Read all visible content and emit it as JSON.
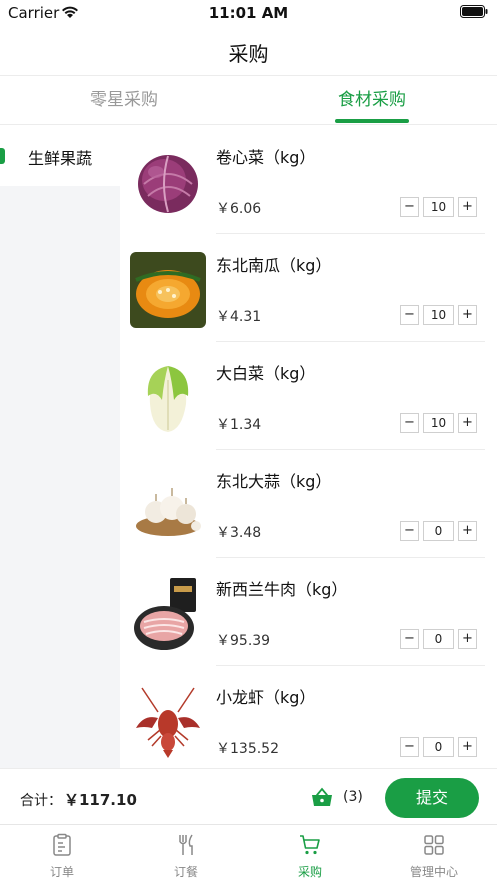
{
  "status_bar": {
    "carrier": "Carrier",
    "time": "11:01 AM"
  },
  "nav": {
    "title": "采购"
  },
  "tabs": [
    {
      "label": "零星采购",
      "active": false
    },
    {
      "label": "食材采购",
      "active": true
    }
  ],
  "sidebar": {
    "items": [
      {
        "label": "生鲜果蔬",
        "active": true
      }
    ]
  },
  "products": [
    {
      "name": "卷心菜（kg）",
      "price": "￥6.06",
      "quantity": "10",
      "image": "red-cabbage"
    },
    {
      "name": "东北南瓜（kg）",
      "price": "￥4.31",
      "quantity": "10",
      "image": "pumpkin"
    },
    {
      "name": "大白菜（kg）",
      "price": "￥1.34",
      "quantity": "10",
      "image": "napa-cabbage"
    },
    {
      "name": "东北大蒜（kg）",
      "price": "￥3.48",
      "quantity": "0",
      "image": "garlic"
    },
    {
      "name": "新西兰牛肉（kg）",
      "price": "￥95.39",
      "quantity": "0",
      "image": "beef-slices"
    },
    {
      "name": "小龙虾（kg）",
      "price": "￥135.52",
      "quantity": "0",
      "image": "crayfish"
    }
  ],
  "stepper": {
    "minus": "−",
    "plus": "+"
  },
  "summary": {
    "total_label": "合计：",
    "total_amount": "￥117.10",
    "cart_count": "(3)",
    "submit_label": "提交"
  },
  "tab_bar": [
    {
      "label": "订单",
      "icon": "clipboard-icon",
      "active": false
    },
    {
      "label": "订餐",
      "icon": "fork-knife-icon",
      "active": false
    },
    {
      "label": "采购",
      "icon": "cart-icon",
      "active": true
    },
    {
      "label": "管理中心",
      "icon": "grid-icon",
      "active": false
    }
  ],
  "colors": {
    "accent": "#1a9e45",
    "inactive_text": "#999999",
    "sidebar_bg": "#f4f5f7",
    "divider": "#ececec"
  }
}
